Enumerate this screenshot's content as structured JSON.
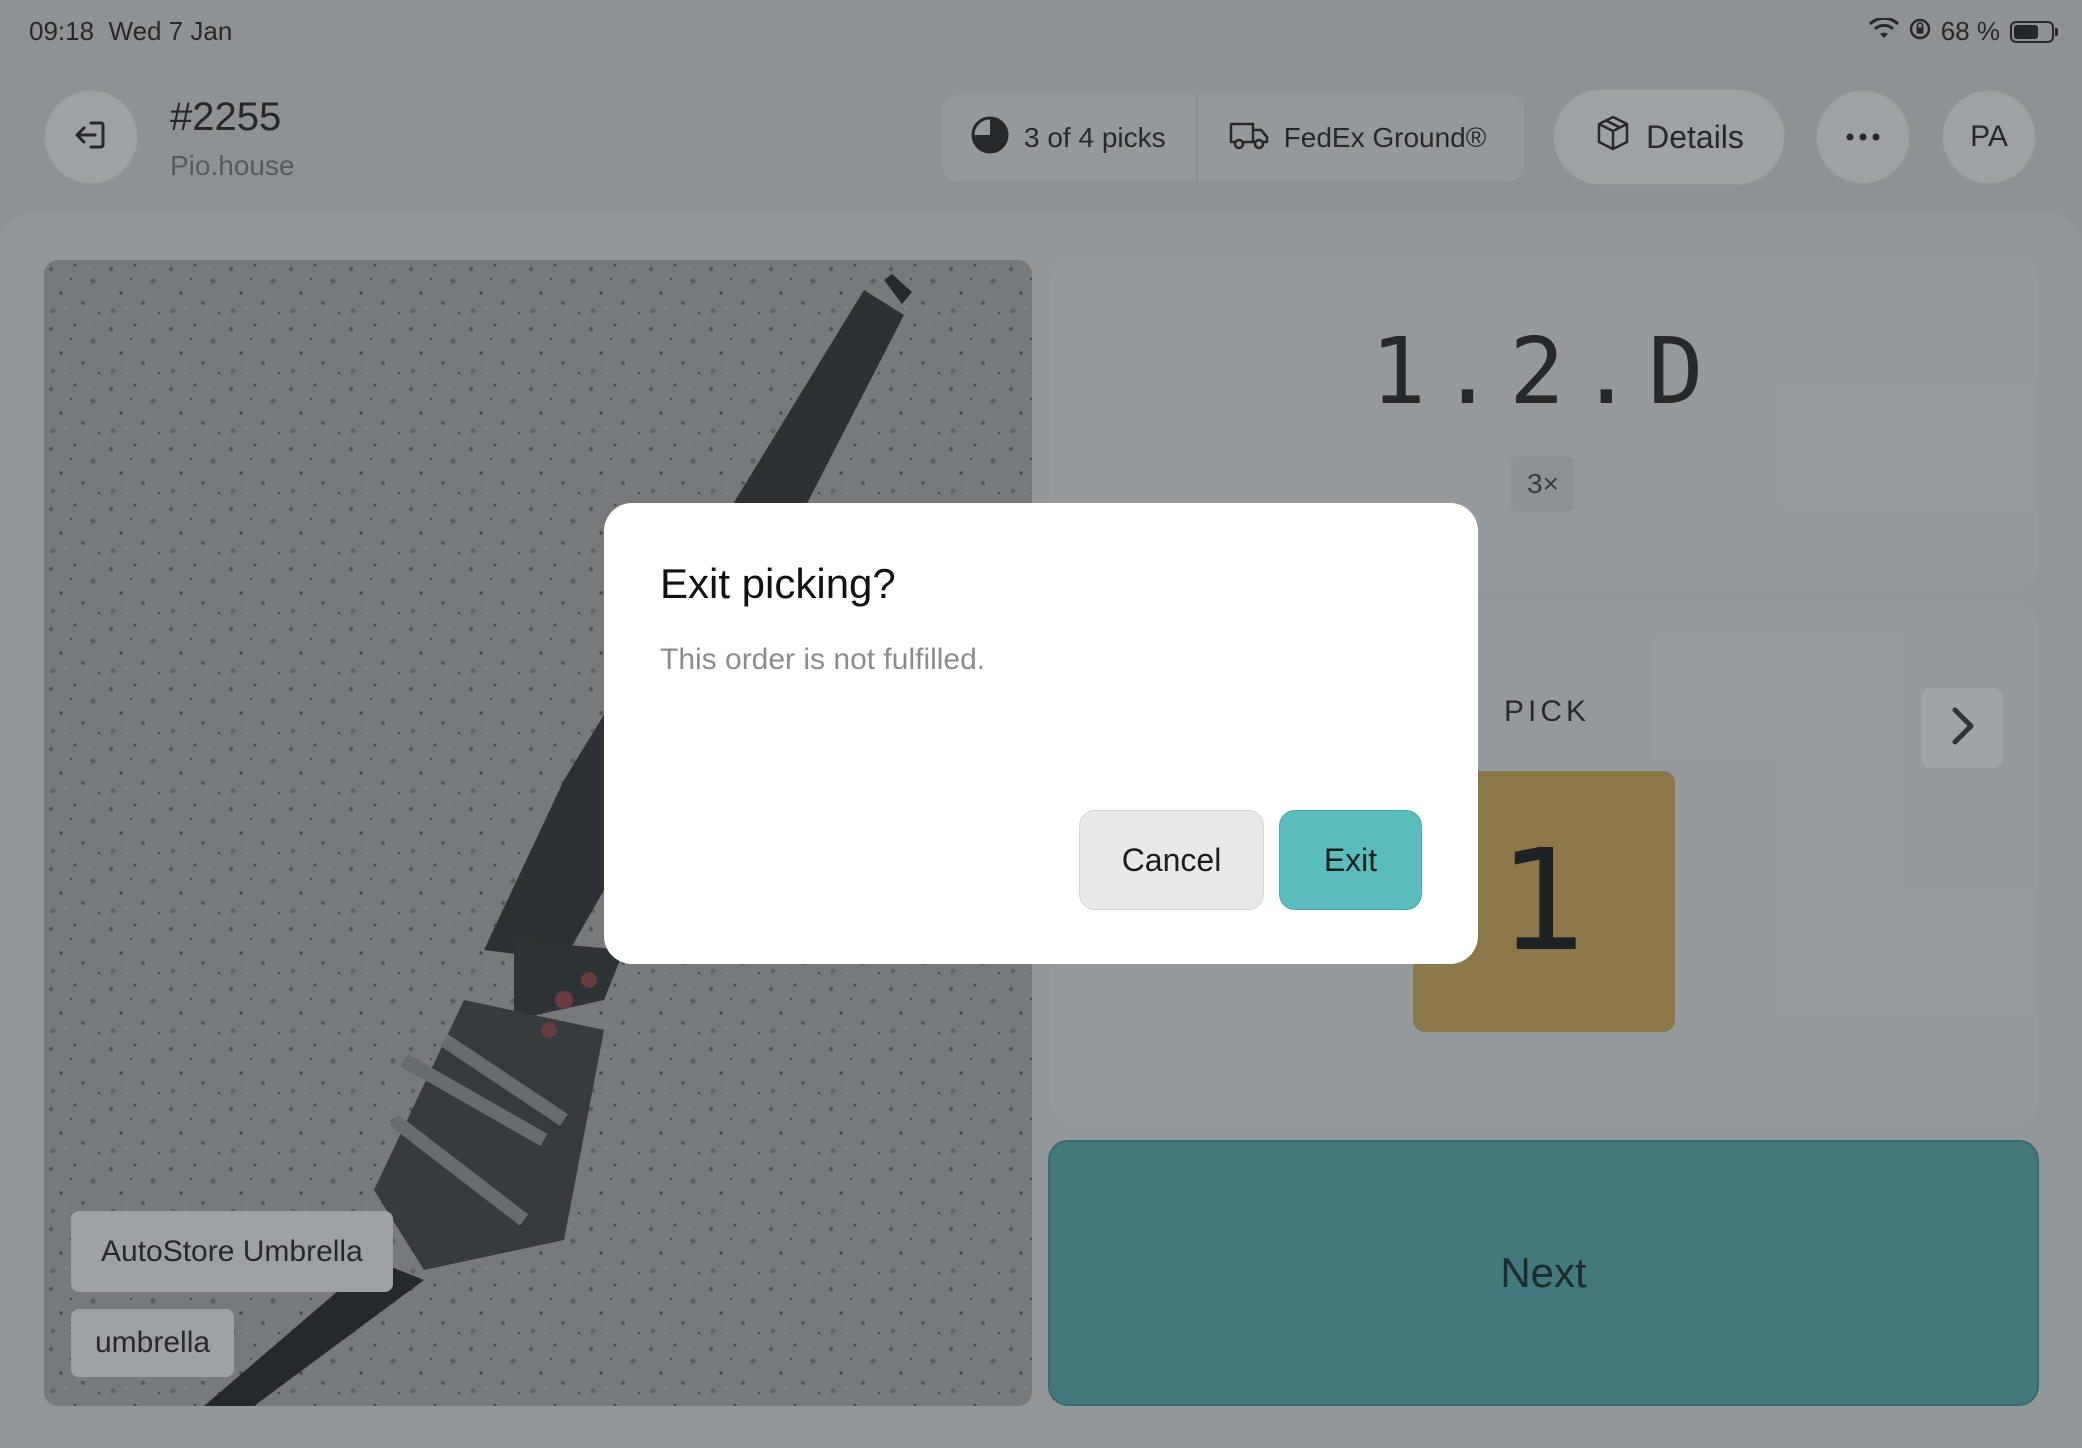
{
  "status_bar": {
    "time": "09:18",
    "date": "Wed 7 Jan",
    "battery": "68 %",
    "battery_level": 0.68,
    "icons": [
      "wifi-icon",
      "screen-lock-icon",
      "battery-icon"
    ]
  },
  "header": {
    "order_number": "#2255",
    "store": "Pio.house",
    "picks_progress": "3 of 4 picks",
    "picks_fraction": 0.75,
    "carrier": "FedEx Ground®",
    "details_label": "Details",
    "more_icon": "more-horizontal-icon",
    "user_initials": "PA"
  },
  "product": {
    "name": "AutoStore Umbrella",
    "tag": "umbrella"
  },
  "location": {
    "code": "1.2.D",
    "quantity_badge": "3×"
  },
  "pick": {
    "label": "PICK",
    "quantity": "1"
  },
  "next_label": "Next",
  "dialog": {
    "title": "Exit picking?",
    "message": "This order is not fulfilled.",
    "cancel_label": "Cancel",
    "exit_label": "Exit"
  },
  "colors": {
    "accent_teal": "#5bbcbc",
    "next_button": "#4fa1a4",
    "pick_qty_bg": "#c6a14e",
    "overlay": "rgba(50,60,66,0.40)"
  }
}
